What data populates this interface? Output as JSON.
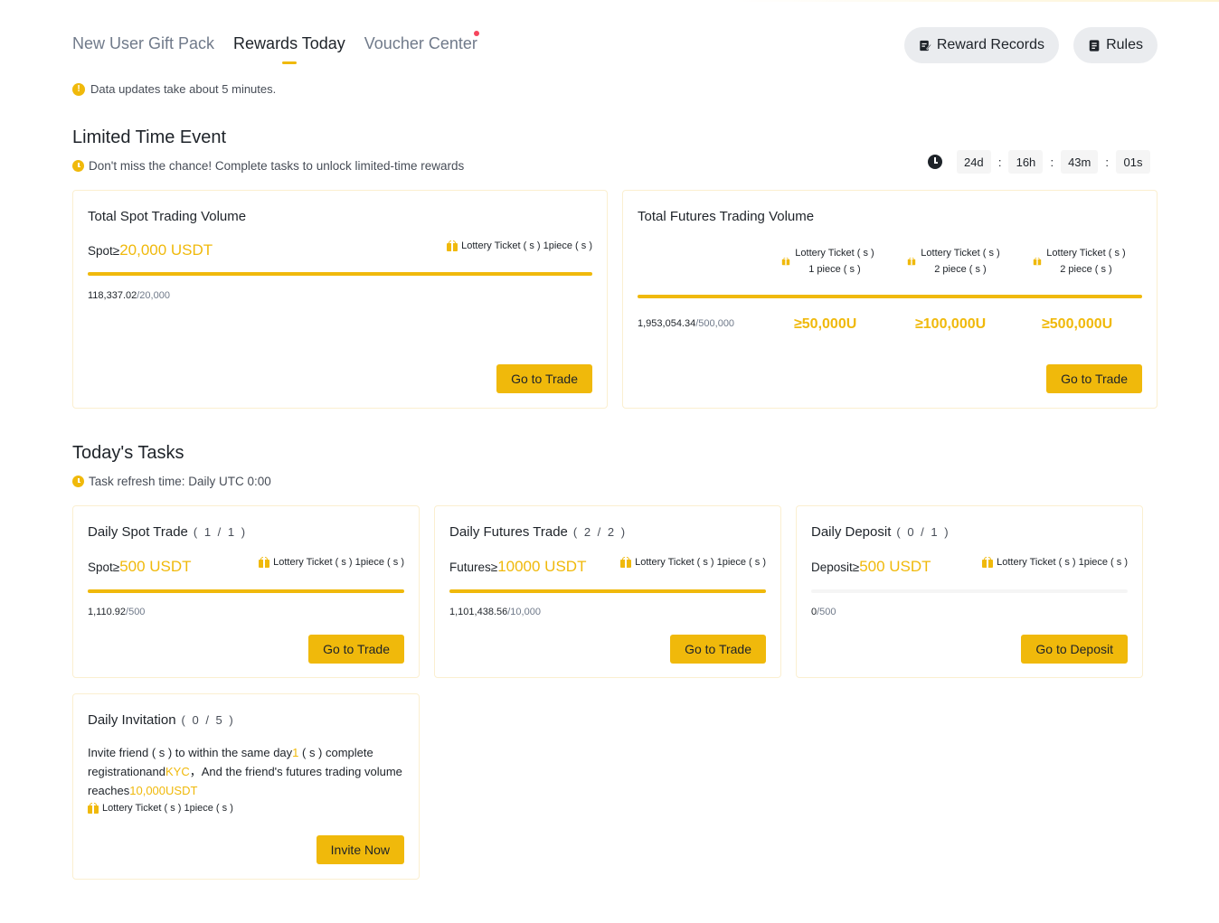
{
  "tabs": [
    {
      "label": "New User Gift Pack"
    },
    {
      "label": "Rewards Today"
    },
    {
      "label": "Voucher Center"
    }
  ],
  "header_buttons": {
    "records": "Reward Records",
    "rules": "Rules"
  },
  "notice": "Data updates take about 5 minutes.",
  "limited": {
    "title": "Limited Time Event",
    "subtitle": "Don't miss the chance! Complete tasks to unlock limited-time rewards",
    "countdown": {
      "days": "24d",
      "hours": "16h",
      "minutes": "43m",
      "seconds": "01s",
      "sep": ":"
    },
    "spot": {
      "title": "Total Spot Trading Volume",
      "target_prefix": "Spot≥",
      "target_amount": "20,000 USDT",
      "reward": "Lottery Ticket ( s ) 1piece ( s )",
      "progress_current": "118,337.02",
      "progress_total": "/20,000",
      "progress_ratio": 1,
      "button": "Go to Trade"
    },
    "futures": {
      "title": "Total Futures Trading Volume",
      "tiers": [
        {
          "reward_line1": "Lottery Ticket ( s )",
          "reward_line2": "1 piece ( s )",
          "amount": "≥50,000U"
        },
        {
          "reward_line1": "Lottery Ticket ( s )",
          "reward_line2": "2 piece ( s )",
          "amount": "≥100,000U"
        },
        {
          "reward_line1": "Lottery Ticket ( s )",
          "reward_line2": "2 piece ( s )",
          "amount": "≥500,000U"
        }
      ],
      "progress_current": "1,953,054.34",
      "progress_total": "/500,000",
      "progress_ratio": 1,
      "button": "Go to Trade"
    }
  },
  "today": {
    "title": "Today's Tasks",
    "subtitle": "Task refresh time: Daily UTC 0:00",
    "tasks": [
      {
        "title": "Daily Spot Trade",
        "count": "( 1 / 1 )",
        "target_prefix": "Spot≥",
        "target_amount": "500 USDT",
        "reward": "Lottery Ticket ( s ) 1piece ( s )",
        "progress_current": "1,110.92",
        "progress_total": "/500",
        "progress_ratio": 1,
        "button": "Go to Trade"
      },
      {
        "title": "Daily Futures Trade",
        "count": "( 2 / 2 )",
        "target_prefix": "Futures≥",
        "target_amount": "10000 USDT",
        "reward": "Lottery Ticket ( s ) 1piece ( s )",
        "progress_current": "1,101,438.56",
        "progress_total": "/10,000",
        "progress_ratio": 1,
        "button": "Go to Trade"
      },
      {
        "title": "Daily Deposit",
        "count": "( 0 / 1 )",
        "target_prefix": "Deposit≥",
        "target_amount": "500 USDT",
        "reward": "Lottery Ticket ( s ) 1piece ( s )",
        "progress_current": "0",
        "progress_total": "/500",
        "progress_ratio": 0,
        "button": "Go to Deposit"
      }
    ],
    "invitation": {
      "title": "Daily Invitation",
      "count": "( 0 / 5 )",
      "desc_1": "Invite friend ( s )  to within the same day",
      "desc_hl1": "1",
      "desc_2": " ( s )  complete registrationand",
      "desc_hl2": "KYC",
      "desc_3": "，And the friend's futures trading volume reaches",
      "desc_hl3": "10,000USDT",
      "reward": "Lottery Ticket ( s ) 1piece ( s )",
      "button": "Invite Now"
    }
  },
  "colors": {
    "accent": "#f0b90b",
    "text": "#1e2329",
    "muted": "#707a8a",
    "badge": "#f6465d",
    "card_border": "#fbefd0"
  }
}
